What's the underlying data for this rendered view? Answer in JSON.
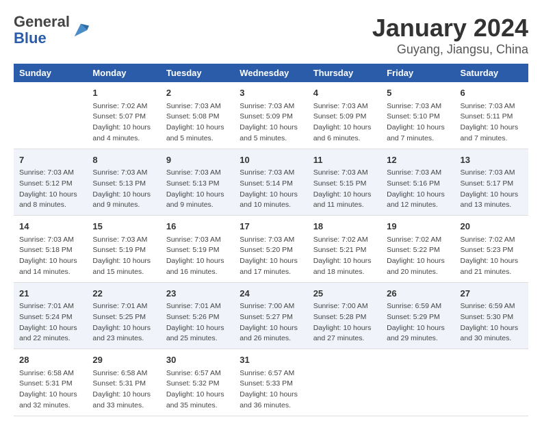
{
  "header": {
    "logo_general": "General",
    "logo_blue": "Blue",
    "month": "January 2024",
    "location": "Guyang, Jiangsu, China"
  },
  "weekdays": [
    "Sunday",
    "Monday",
    "Tuesday",
    "Wednesday",
    "Thursday",
    "Friday",
    "Saturday"
  ],
  "weeks": [
    [
      {
        "day": "",
        "info": ""
      },
      {
        "day": "1",
        "info": "Sunrise: 7:02 AM\nSunset: 5:07 PM\nDaylight: 10 hours\nand 4 minutes."
      },
      {
        "day": "2",
        "info": "Sunrise: 7:03 AM\nSunset: 5:08 PM\nDaylight: 10 hours\nand 5 minutes."
      },
      {
        "day": "3",
        "info": "Sunrise: 7:03 AM\nSunset: 5:09 PM\nDaylight: 10 hours\nand 5 minutes."
      },
      {
        "day": "4",
        "info": "Sunrise: 7:03 AM\nSunset: 5:09 PM\nDaylight: 10 hours\nand 6 minutes."
      },
      {
        "day": "5",
        "info": "Sunrise: 7:03 AM\nSunset: 5:10 PM\nDaylight: 10 hours\nand 7 minutes."
      },
      {
        "day": "6",
        "info": "Sunrise: 7:03 AM\nSunset: 5:11 PM\nDaylight: 10 hours\nand 7 minutes."
      }
    ],
    [
      {
        "day": "7",
        "info": "Sunrise: 7:03 AM\nSunset: 5:12 PM\nDaylight: 10 hours\nand 8 minutes."
      },
      {
        "day": "8",
        "info": "Sunrise: 7:03 AM\nSunset: 5:13 PM\nDaylight: 10 hours\nand 9 minutes."
      },
      {
        "day": "9",
        "info": "Sunrise: 7:03 AM\nSunset: 5:13 PM\nDaylight: 10 hours\nand 9 minutes."
      },
      {
        "day": "10",
        "info": "Sunrise: 7:03 AM\nSunset: 5:14 PM\nDaylight: 10 hours\nand 10 minutes."
      },
      {
        "day": "11",
        "info": "Sunrise: 7:03 AM\nSunset: 5:15 PM\nDaylight: 10 hours\nand 11 minutes."
      },
      {
        "day": "12",
        "info": "Sunrise: 7:03 AM\nSunset: 5:16 PM\nDaylight: 10 hours\nand 12 minutes."
      },
      {
        "day": "13",
        "info": "Sunrise: 7:03 AM\nSunset: 5:17 PM\nDaylight: 10 hours\nand 13 minutes."
      }
    ],
    [
      {
        "day": "14",
        "info": "Sunrise: 7:03 AM\nSunset: 5:18 PM\nDaylight: 10 hours\nand 14 minutes."
      },
      {
        "day": "15",
        "info": "Sunrise: 7:03 AM\nSunset: 5:19 PM\nDaylight: 10 hours\nand 15 minutes."
      },
      {
        "day": "16",
        "info": "Sunrise: 7:03 AM\nSunset: 5:19 PM\nDaylight: 10 hours\nand 16 minutes."
      },
      {
        "day": "17",
        "info": "Sunrise: 7:03 AM\nSunset: 5:20 PM\nDaylight: 10 hours\nand 17 minutes."
      },
      {
        "day": "18",
        "info": "Sunrise: 7:02 AM\nSunset: 5:21 PM\nDaylight: 10 hours\nand 18 minutes."
      },
      {
        "day": "19",
        "info": "Sunrise: 7:02 AM\nSunset: 5:22 PM\nDaylight: 10 hours\nand 20 minutes."
      },
      {
        "day": "20",
        "info": "Sunrise: 7:02 AM\nSunset: 5:23 PM\nDaylight: 10 hours\nand 21 minutes."
      }
    ],
    [
      {
        "day": "21",
        "info": "Sunrise: 7:01 AM\nSunset: 5:24 PM\nDaylight: 10 hours\nand 22 minutes."
      },
      {
        "day": "22",
        "info": "Sunrise: 7:01 AM\nSunset: 5:25 PM\nDaylight: 10 hours\nand 23 minutes."
      },
      {
        "day": "23",
        "info": "Sunrise: 7:01 AM\nSunset: 5:26 PM\nDaylight: 10 hours\nand 25 minutes."
      },
      {
        "day": "24",
        "info": "Sunrise: 7:00 AM\nSunset: 5:27 PM\nDaylight: 10 hours\nand 26 minutes."
      },
      {
        "day": "25",
        "info": "Sunrise: 7:00 AM\nSunset: 5:28 PM\nDaylight: 10 hours\nand 27 minutes."
      },
      {
        "day": "26",
        "info": "Sunrise: 6:59 AM\nSunset: 5:29 PM\nDaylight: 10 hours\nand 29 minutes."
      },
      {
        "day": "27",
        "info": "Sunrise: 6:59 AM\nSunset: 5:30 PM\nDaylight: 10 hours\nand 30 minutes."
      }
    ],
    [
      {
        "day": "28",
        "info": "Sunrise: 6:58 AM\nSunset: 5:31 PM\nDaylight: 10 hours\nand 32 minutes."
      },
      {
        "day": "29",
        "info": "Sunrise: 6:58 AM\nSunset: 5:31 PM\nDaylight: 10 hours\nand 33 minutes."
      },
      {
        "day": "30",
        "info": "Sunrise: 6:57 AM\nSunset: 5:32 PM\nDaylight: 10 hours\nand 35 minutes."
      },
      {
        "day": "31",
        "info": "Sunrise: 6:57 AM\nSunset: 5:33 PM\nDaylight: 10 hours\nand 36 minutes."
      },
      {
        "day": "",
        "info": ""
      },
      {
        "day": "",
        "info": ""
      },
      {
        "day": "",
        "info": ""
      }
    ]
  ]
}
